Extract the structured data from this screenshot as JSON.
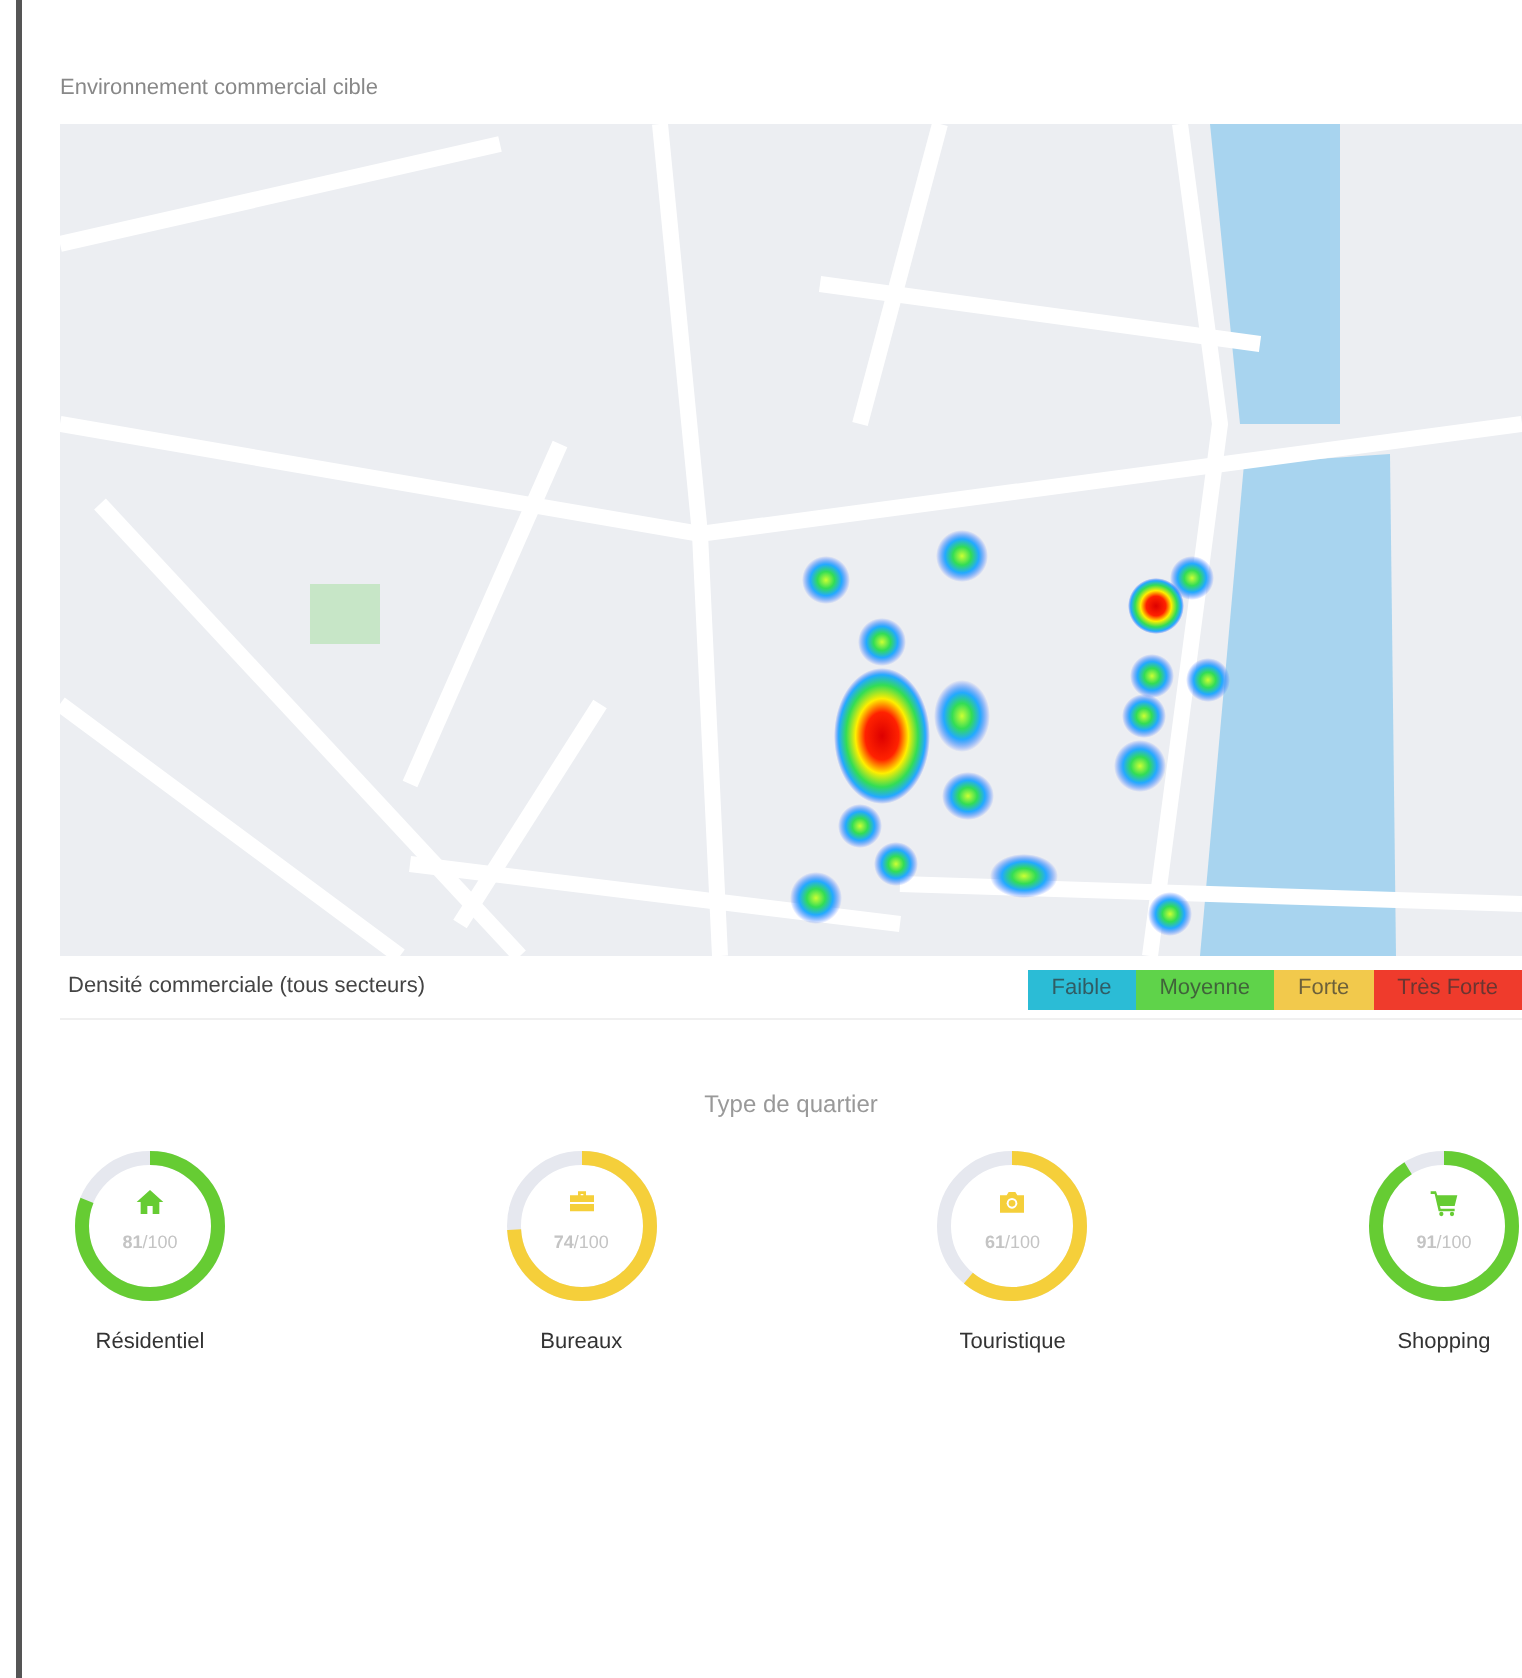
{
  "section_title": "Environnement commercial cible",
  "map": {
    "legend_caption": "Densité commerciale (tous secteurs)",
    "legend": [
      {
        "label": "Faible",
        "color": "#2bbcd6"
      },
      {
        "label": "Moyenne",
        "color": "#5fd34a"
      },
      {
        "label": "Forte",
        "color": "#f2c94c"
      },
      {
        "label": "Très Forte",
        "color": "#ef3b2c"
      }
    ]
  },
  "district_types": {
    "title": "Type de quartier",
    "items": [
      {
        "kind": "house",
        "label": "Résidentiel",
        "score": "81",
        "max": "/100",
        "level": 0.81,
        "color": "#66cc33"
      },
      {
        "kind": "briefcase",
        "label": "Bureaux",
        "score": "74",
        "max": "/100",
        "level": 0.74,
        "color": "#f5cf3a"
      },
      {
        "kind": "camera",
        "label": "Touristique",
        "score": "61",
        "max": "/100",
        "level": 0.61,
        "color": "#f5cf3a"
      },
      {
        "kind": "cart",
        "label": "Shopping",
        "score": "91",
        "max": "/100",
        "level": 0.91,
        "color": "#66cc33"
      }
    ]
  }
}
